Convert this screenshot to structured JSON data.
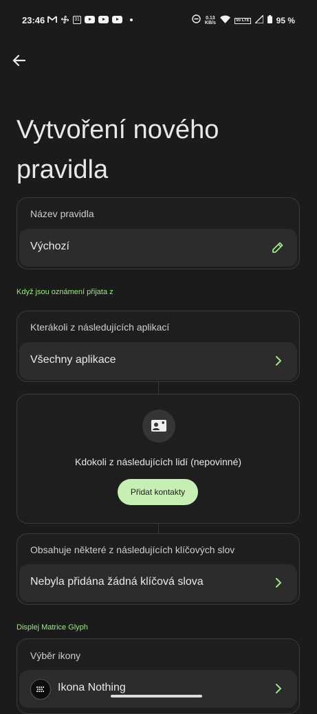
{
  "status_bar": {
    "time": "23:46",
    "speed_value": "0.13",
    "speed_unit": "KB/s",
    "battery": "95 %",
    "volte": "Vo LTE",
    "calendar_day": "31"
  },
  "page": {
    "title": "Vytvoření nového pravidla"
  },
  "rule_name": {
    "label": "Název pravidla",
    "value": "Výchozí"
  },
  "section_notifications": "Když jsou oznámení přijata z",
  "apps": {
    "label": "Kterákoli z následujících aplikací",
    "value": "Všechny aplikace"
  },
  "people": {
    "text": "Kdokoli z následujících lidí (nepovinné)",
    "button": "Přidat kontakty"
  },
  "keywords": {
    "label": "Obsahuje některé z následujících klíčových slov",
    "value": "Nebyla přidána žádná klíčová slova"
  },
  "section_glyph": "Displej Matrice Glyph",
  "icon_select": {
    "label": "Výběr ikony",
    "value": "Ikona Nothing"
  },
  "colors": {
    "background": "#1b1b1b",
    "accent": "#9fe98a",
    "button_bg": "#c7efb4"
  }
}
